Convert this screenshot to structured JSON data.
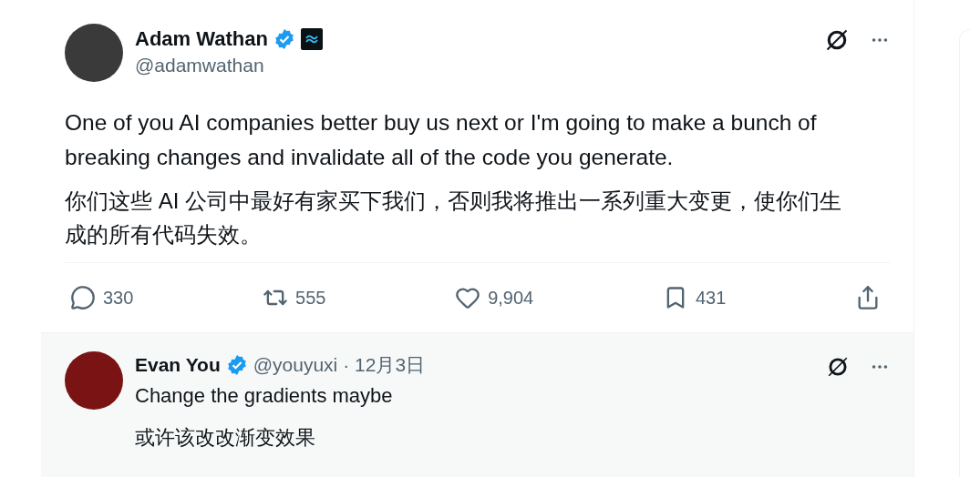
{
  "tweet": {
    "author": {
      "name": "Adam Wathan",
      "handle": "@adamwathan",
      "verified": true
    },
    "paragraphs": [
      "One of you AI companies better buy us next or I'm going to make a bunch of breaking changes and invalidate all of the code you generate.",
      "你们这些 AI 公司中最好有家买下我们，否则我将推出一系列重大变更，使你们生成的所有代码失效。"
    ],
    "actions": [
      {
        "kind": "reply",
        "count": "330"
      },
      {
        "kind": "repost",
        "count": "555"
      },
      {
        "kind": "like",
        "count": "9,904"
      },
      {
        "kind": "bookmark",
        "count": "431"
      },
      {
        "kind": "share"
      }
    ]
  },
  "reply": {
    "author": {
      "name": "Evan You",
      "handle": "@youyuxi",
      "verified": true
    },
    "date": "· 12月3日",
    "paragraphs": [
      "Change the gradients maybe",
      "或许该改改渐变效果"
    ]
  }
}
